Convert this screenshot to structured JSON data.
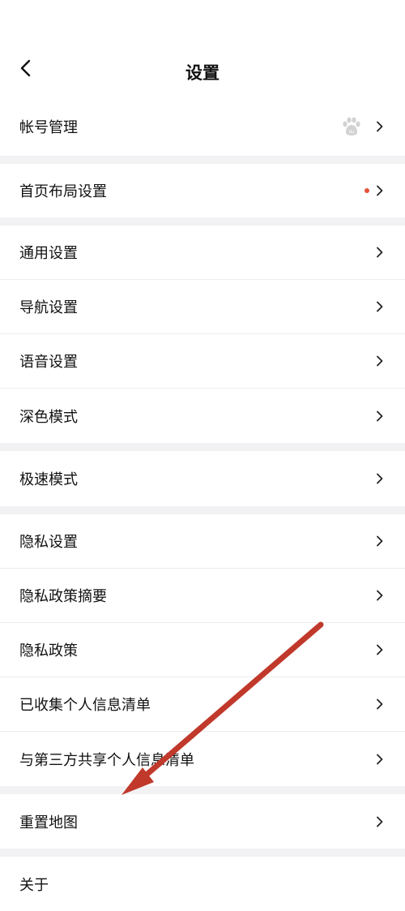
{
  "header": {
    "title": "设置"
  },
  "groups": [
    {
      "items": [
        {
          "label": "帐号管理",
          "right": "baidu-paw-icon"
        }
      ]
    },
    {
      "items": [
        {
          "label": "首页布局设置",
          "right": "red-dot"
        }
      ]
    },
    {
      "items": [
        {
          "label": "通用设置"
        },
        {
          "label": "导航设置"
        },
        {
          "label": "语音设置"
        },
        {
          "label": "深色模式"
        }
      ]
    },
    {
      "items": [
        {
          "label": "极速模式"
        }
      ]
    },
    {
      "items": [
        {
          "label": "隐私设置"
        },
        {
          "label": "隐私政策摘要"
        },
        {
          "label": "隐私政策"
        },
        {
          "label": "已收集个人信息清单"
        },
        {
          "label": "与第三方共享个人信息清单"
        }
      ]
    },
    {
      "items": [
        {
          "label": "重置地图"
        }
      ]
    },
    {
      "items": [
        {
          "label": "关于"
        }
      ]
    }
  ],
  "colors": {
    "annotation_arrow": "#c0392b",
    "notification_dot": "#e5533a",
    "background": "#f2f2f4"
  },
  "icons": {
    "back": "back-chevron-icon",
    "chevron": "chevron-right-icon",
    "account": "baidu-paw-icon"
  }
}
